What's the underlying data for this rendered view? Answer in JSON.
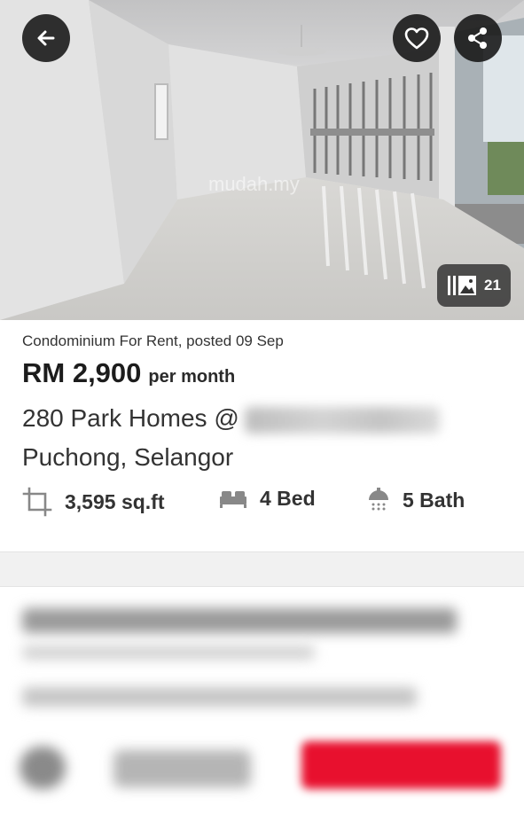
{
  "hero": {
    "watermark": "mudah.my",
    "gallery_count": "21",
    "icons": {
      "back": "back-arrow-icon",
      "favorite": "heart-icon",
      "share": "share-icon",
      "gallery": "gallery-icon"
    }
  },
  "listing": {
    "subtitle": "Condominium For Rent, posted 09 Sep",
    "price": "RM 2,900",
    "price_unit": "per month",
    "address_line1": "280 Park Homes @",
    "address_line2": "Puchong, Selangor",
    "size": "3,595 sq.ft",
    "beds": "4 Bed",
    "baths": "5 Bath"
  },
  "colors": {
    "accent": "#e8102e",
    "icon_gray": "#888888",
    "overlay_button": "#141414"
  }
}
